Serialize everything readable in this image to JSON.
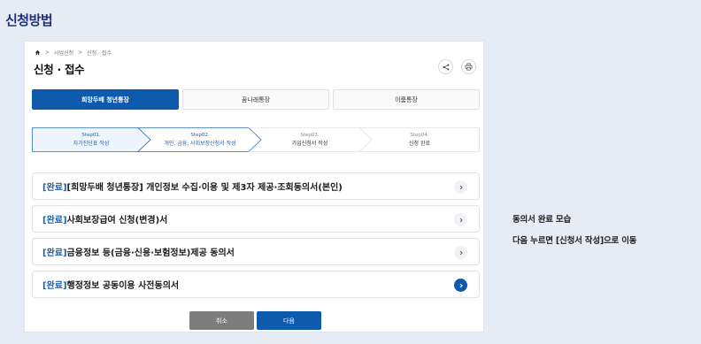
{
  "slide": {
    "title": "신청방법",
    "notes": [
      "동의서 완료 모습",
      "다음 누르면 [신청서 작성]으로 이동"
    ]
  },
  "breadcrumb": [
    "사업신청",
    "신청 · 접수"
  ],
  "page_title": "신청 · 접수",
  "toolbar": {
    "share_icon": "share-icon",
    "print_icon": "print-icon"
  },
  "tabs": [
    {
      "label": "희망두배 청년통장",
      "active": true
    },
    {
      "label": "꿈나래통장",
      "active": false
    },
    {
      "label": "이룸통장",
      "active": false
    }
  ],
  "steps": [
    {
      "num": "Step01.",
      "label": "자가진단표 작성"
    },
    {
      "num": "Step02.",
      "label": "개인, 금융, 사회보장신청서 작성"
    },
    {
      "num": "Step03.",
      "label": "가입신청서 작성"
    },
    {
      "num": "Step04.",
      "label": "신청 완료"
    }
  ],
  "documents": [
    {
      "status": "[완료]",
      "title": "[희망두배 청년통장] 개인정보 수집·이용 및 제3자 제공·조회동의서(본인)"
    },
    {
      "status": "[완료]",
      "title": "사회보장급여 신청(변경)서"
    },
    {
      "status": "[완료]",
      "title": "금융정보 등(금융·신용·보험정보)제공 동의서"
    },
    {
      "status": "[완료]",
      "title": "행정정보 공동이용 사전동의서"
    }
  ],
  "buttons": {
    "cancel": "취소",
    "next": "다음"
  },
  "colors": {
    "primary": "#0e5aad",
    "title": "#1f2f7a",
    "cancel": "#7d7d7d"
  }
}
